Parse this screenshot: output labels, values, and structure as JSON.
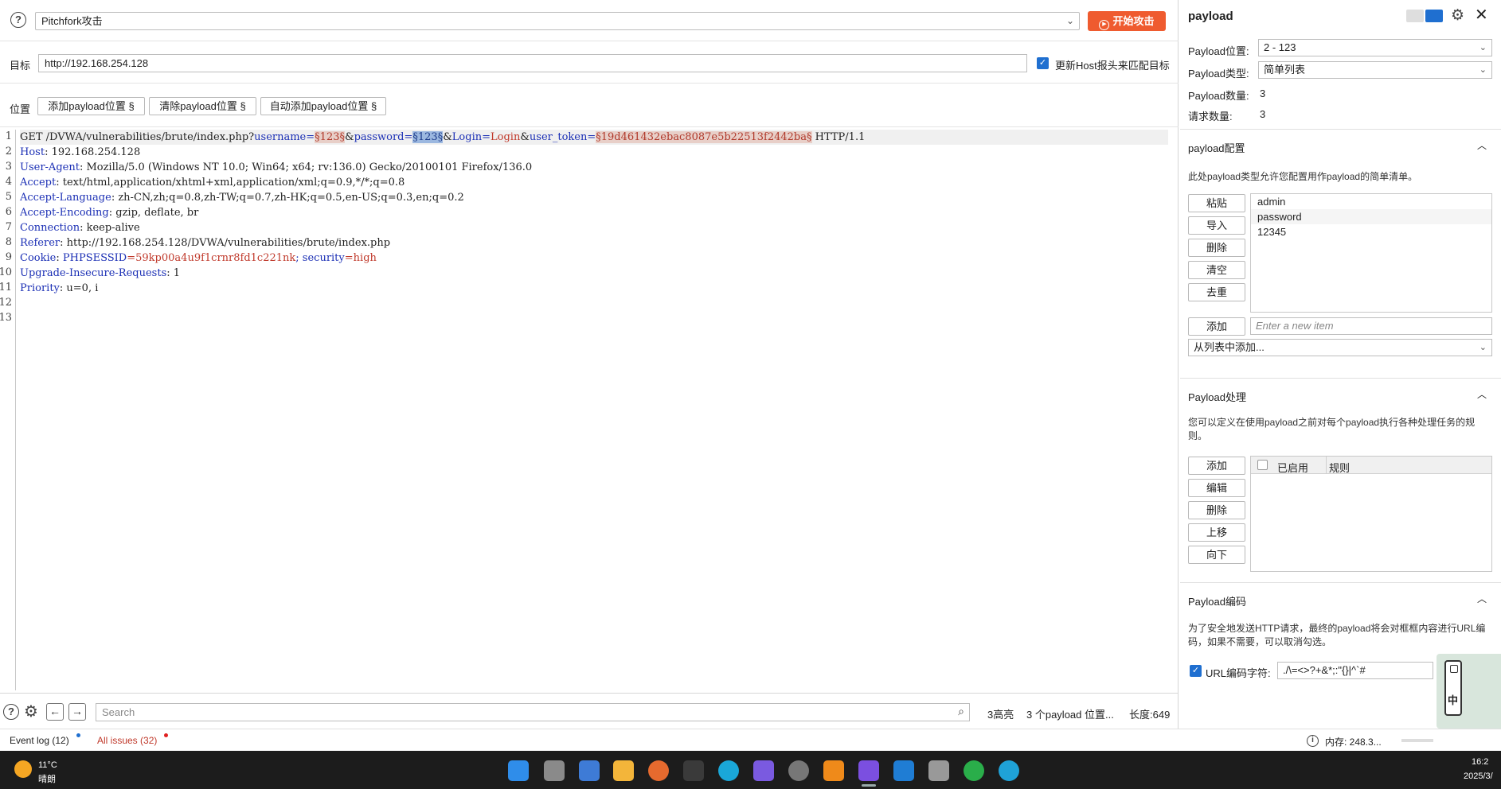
{
  "attack": {
    "type": "Pitchfork攻击",
    "start_label": "开始攻击"
  },
  "target": {
    "label": "目标",
    "url": "http://192.168.254.128",
    "update_host_label": "更新Host报头来匹配目标",
    "update_host_checked": true
  },
  "positions": {
    "label": "位置",
    "add_label": "添加payload位置 §",
    "clear_label": "清除payload位置 §",
    "auto_label": "自动添加payload位置 §"
  },
  "request": {
    "line_numbers": [
      "1",
      "2",
      "3",
      "4",
      "5",
      "6",
      "7",
      "8",
      "9",
      "10",
      "11",
      "12",
      "13"
    ],
    "line1": {
      "method_path": "GET /DVWA/vulnerabilities/brute/index.php?",
      "k_username": "username",
      "eq1": "=",
      "p1": "§123§",
      "amp1": "&",
      "k_password": "password",
      "eq2": "=",
      "p2": "§123§",
      "amp2": "&",
      "k_login": "Login",
      "eq3": "=",
      "v_login": "Login",
      "amp3": "&",
      "k_token": "user_token",
      "eq4": "=",
      "p3": "§19d461432ebac8087e5b22513f2442ba§",
      "proto": " HTTP/1.1"
    },
    "headers": [
      {
        "k": "Host",
        "v": ": 192.168.254.128"
      },
      {
        "k": "User-Agent",
        "v": ": Mozilla/5.0 (Windows NT 10.0; Win64; x64; rv:136.0) Gecko/20100101 Firefox/136.0"
      },
      {
        "k": "Accept",
        "v": ": text/html,application/xhtml+xml,application/xml;q=0.9,*/*;q=0.8"
      },
      {
        "k": "Accept-Language",
        "v": ": zh-CN,zh;q=0.8,zh-TW;q=0.7,zh-HK;q=0.5,en-US;q=0.3,en;q=0.2"
      },
      {
        "k": "Accept-Encoding",
        "v": ": gzip, deflate, br"
      },
      {
        "k": "Connection",
        "v": ": keep-alive"
      },
      {
        "k": "Referer",
        "v": ": http://192.168.254.128/DVWA/vulnerabilities/brute/index.php"
      }
    ],
    "cookie": {
      "k": "Cookie",
      "colon": ": ",
      "k1": "PHPSESSID",
      "eq1": "=",
      "v1": "59kp00a4u9f1crnr8fd1c221nk",
      "sep": "; ",
      "k2": "security",
      "eq2": "=",
      "v2": "high"
    },
    "tail_headers": [
      {
        "k": "Upgrade-Insecure-Requests",
        "v": ": 1"
      },
      {
        "k": "Priority",
        "v": ": u=0, i"
      }
    ]
  },
  "search": {
    "placeholder": "Search",
    "highlights": "3高亮",
    "payload_positions": "3 个payload 位置...",
    "length": "长度:649"
  },
  "status": {
    "event_log": "Event log (12)",
    "all_issues": "All issues (32)",
    "memory": "内存: 248.3..."
  },
  "payload_panel": {
    "title": "payload",
    "position_label": "Payload位置:",
    "position_value": "2 - 123",
    "type_label": "Payload类型:",
    "type_value": "简单列表",
    "count_label": "Payload数量:",
    "count_value": "3",
    "request_label": "请求数量:",
    "request_value": "3"
  },
  "payload_config": {
    "title": "payload配置",
    "desc": "此处payload类型允许您配置用作payload的简单清单。",
    "buttons": [
      "粘贴",
      "导入",
      "删除",
      "清空",
      "去重"
    ],
    "items": [
      "admin",
      "password",
      "12345"
    ],
    "add_label": "添加",
    "new_item_placeholder": "Enter a new item",
    "add_from_list": "从列表中添加..."
  },
  "payload_processing": {
    "title": "Payload处理",
    "desc": "您可以定义在使用payload之前对每个payload执行各种处理任务的规则。",
    "buttons": [
      "添加",
      "编辑",
      "删除",
      "上移",
      "向下"
    ],
    "col_enabled": "已启用",
    "col_rule": "规则"
  },
  "payload_encoding": {
    "title": "Payload编码",
    "desc": "为了安全地发送HTTP请求，最终的payload将会对框框内容进行URL编码，如果不需要，可以取消勾选。",
    "url_encode_label": "URL编码字符:",
    "url_encode_chars": "./\\=<>?+&*;:\"{}|^`#",
    "checked": true
  },
  "ime": {
    "mode": "中"
  },
  "taskbar": {
    "temp": "11°C",
    "weather": "晴朗",
    "time": "16:2",
    "date": "2025/3/"
  },
  "colors": {
    "accent_orange": "#ef5b2f",
    "checkbox_blue": "#1f6fd0",
    "payload_marker_bg": "#e8cfc8",
    "key_blue": "#1b2fb5",
    "value_red": "#c0392b"
  }
}
